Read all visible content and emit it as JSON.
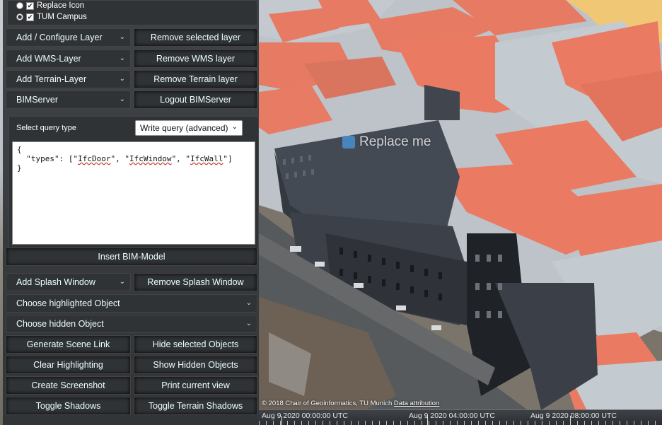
{
  "layers": {
    "items": [
      {
        "label": "Replace Icon",
        "radio": false,
        "checked": true
      },
      {
        "label": "TUM Campus",
        "radio": true,
        "checked": true
      }
    ]
  },
  "toolbar": {
    "add_configure_layer": "Add / Configure Layer",
    "remove_selected_layer": "Remove selected layer",
    "add_wms_layer": "Add WMS-Layer",
    "remove_wms_layer": "Remove WMS layer",
    "add_terrain_layer": "Add Terrain-Layer",
    "remove_terrain_layer": "Remove Terrain layer",
    "bimserver": "BIMServer",
    "logout_bimserver": "Logout BIMServer",
    "insert_bim_model": "Insert BIM-Model",
    "add_splash_window": "Add Splash Window",
    "remove_splash_window": "Remove Splash Window",
    "choose_highlighted_object": "Choose highlighted Object",
    "choose_hidden_object": "Choose hidden Object",
    "generate_scene_link": "Generate Scene Link",
    "hide_selected_objects": "Hide selected Objects",
    "clear_highlighting": "Clear Highlighting",
    "show_hidden_objects": "Show Hidden Objects",
    "create_screenshot": "Create Screenshot",
    "print_current_view": "Print current view",
    "toggle_shadows": "Toggle Shadows",
    "toggle_terrain_shadows": "Toggle Terrain Shadows"
  },
  "query": {
    "label": "Select query type",
    "type_value": "Write query (advanced)",
    "text_open": "{",
    "text_types_prefix": "  \"types\": [\"",
    "type1": "IfcDoor",
    "type2": "IfcWindow",
    "type3": "IfcWall",
    "text_close": "}"
  },
  "map": {
    "overlay_label": "Replace me",
    "attribution": "© 2018 Chair of Geoinformatics, TU Munich",
    "attribution_link": "Data attribution"
  },
  "timeline": {
    "labels": [
      "Aug 9 2020 00:00:00 UTC",
      "Aug 9 2020 04:00:00 UTC",
      "Aug 9 2020 08:00:00 UTC"
    ]
  },
  "colors": {
    "roof": "#ea7a62",
    "roof_flat": "#c4cbd0",
    "building_dark": "#3c4149",
    "building_darker": "#23272d",
    "panel_bg": "#2a2d32",
    "button_bg": "#303336"
  }
}
